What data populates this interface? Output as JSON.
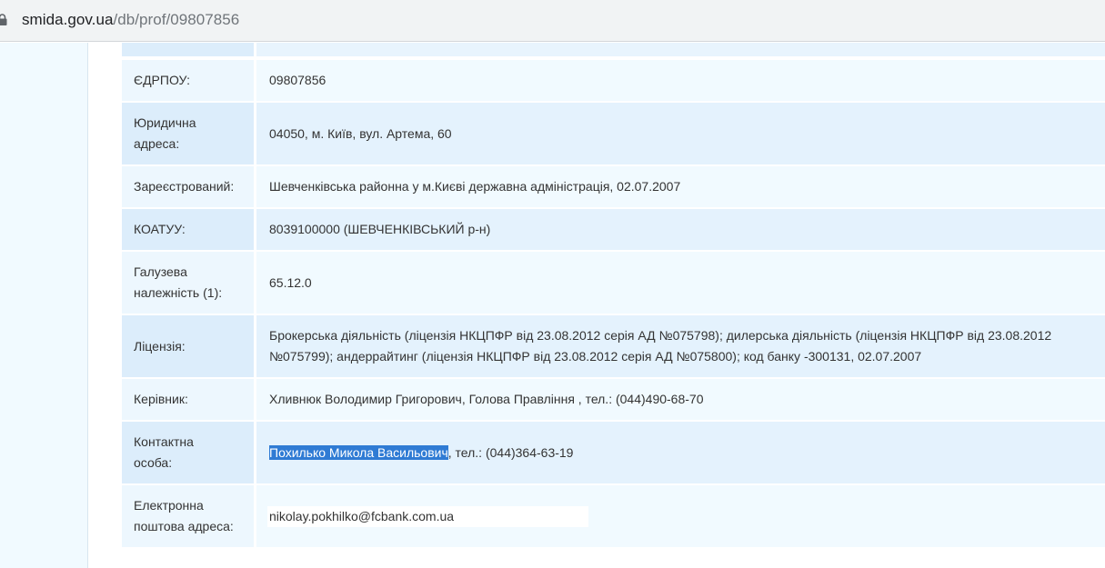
{
  "browser": {
    "url_host": "smida.gov.ua",
    "url_path": "/db/prof/09807856"
  },
  "rows": [
    {
      "label": "ЄДРПОУ:",
      "value": "09807856"
    },
    {
      "label_lines": [
        "Юридична",
        "адреса:"
      ],
      "value": "04050, м. Київ, вул. Артема, 60"
    },
    {
      "label": "Зареєстрований:",
      "value": "Шевченківська районна у м.Києві державна адміністрація, 02.07.2007"
    },
    {
      "label": "КОАТУУ:",
      "value": "8039100000 (ШЕВЧЕНКІВСЬКИЙ р-н)"
    },
    {
      "label_lines": [
        "Галузева",
        "належність (1):"
      ],
      "value": "65.12.0"
    },
    {
      "label": "Ліцензія:",
      "value_lines": [
        "Брокерська діяльність (ліцензія НКЦПФР від 23.08.2012 серія АД №075798); дилерська діяльність (ліцензія НКЦПФР від 23.08.2012",
        "№075799); андеррайтинг (ліцензія НКЦПФР від 23.08.2012 серія АД №075800); код банку -300131, 02.07.2007"
      ]
    },
    {
      "label": "Керівник:",
      "value": "Хливнюк Володимир Григорович, Голова Правління , тел.: (044)490-68-70"
    },
    {
      "label_lines": [
        "Контактна",
        "особа:"
      ],
      "value_highlight": "Похилько Микола Васильович",
      "value_rest": ", тел.: (044)364-63-19"
    },
    {
      "label_lines": [
        "Електронна",
        "поштова адреса:"
      ],
      "value": "nikolay.pokhilko@fcbank.com.ua"
    }
  ]
}
